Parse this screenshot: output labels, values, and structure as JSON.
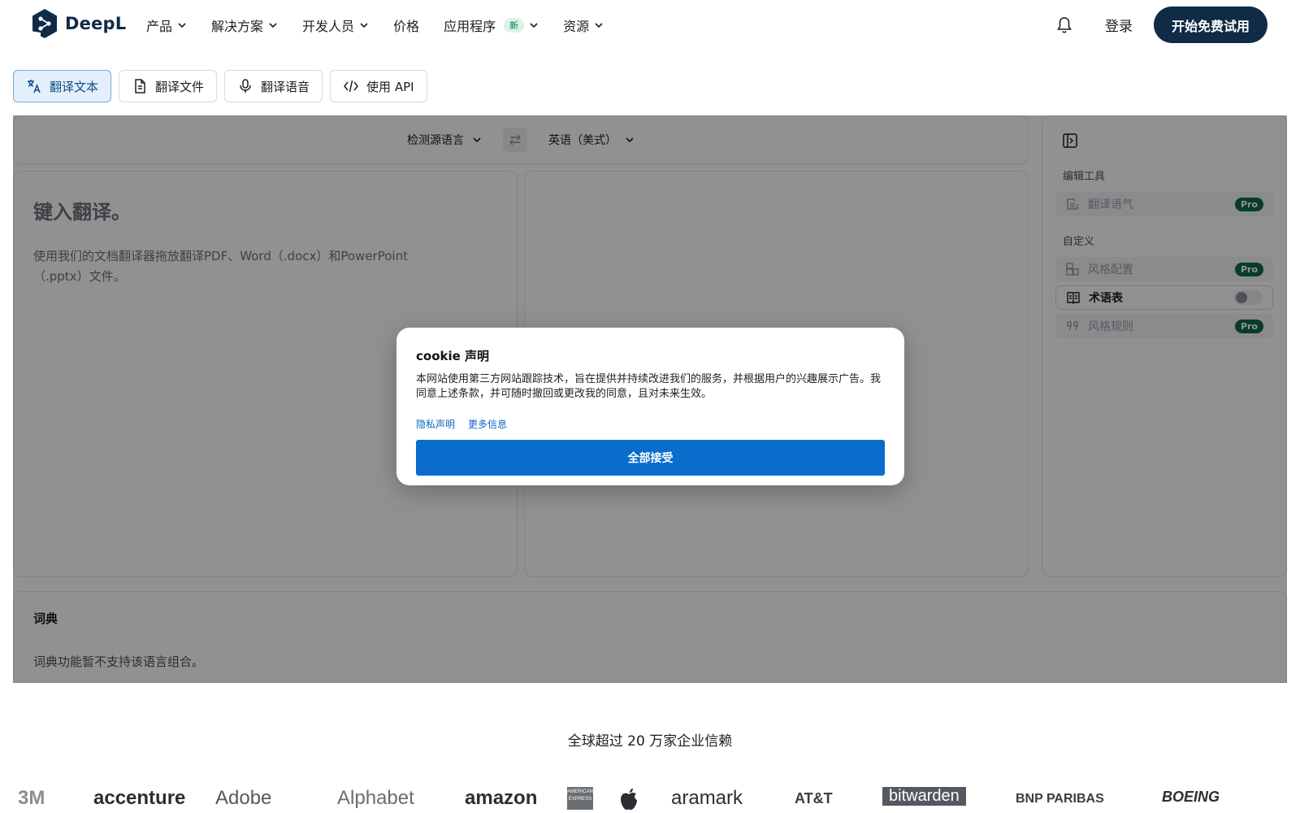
{
  "header": {
    "logo_text": "DeepL",
    "nav": [
      {
        "label": "产品",
        "has_menu": true
      },
      {
        "label": "解决方案",
        "has_menu": true
      },
      {
        "label": "开发人员",
        "has_menu": true
      },
      {
        "label": "价格",
        "has_menu": false
      },
      {
        "label": "应用程序",
        "badge": "新",
        "has_menu": true
      },
      {
        "label": "资源",
        "has_menu": true
      }
    ],
    "login": "登录",
    "cta": "开始免费试用"
  },
  "tabs": [
    {
      "label": "翻译文本",
      "icon": "translate-icon",
      "active": true
    },
    {
      "label": "翻译文件",
      "icon": "document-icon",
      "active": false
    },
    {
      "label": "翻译语音",
      "icon": "microphone-icon",
      "active": false
    },
    {
      "label": "使用 API",
      "icon": "code-icon",
      "active": false
    }
  ],
  "translator": {
    "source_lang": "检测源语言",
    "target_lang": "英语（美式）",
    "source_placeholder": "键入翻译。",
    "source_hint": "使用我们的文档翻译器拖放翻译PDF、Word（.docx）和PowerPoint（.pptx）文件。"
  },
  "sidebar": {
    "section_edit": "编辑工具",
    "section_custom": "自定义",
    "items": {
      "tone": {
        "label": "翻译语气",
        "badge": "Pro"
      },
      "style_config": {
        "label": "风格配置",
        "badge": "Pro"
      },
      "glossary": {
        "label": "术语表",
        "toggle_on": false
      },
      "style_rules": {
        "label": "风格规则",
        "badge": "Pro"
      }
    }
  },
  "dictionary": {
    "title": "词典",
    "message": "词典功能暂不支持该语言组合。"
  },
  "cookie": {
    "title": "cookie 声明",
    "body": "本网站使用第三方网站跟踪技术，旨在提供并持续改进我们的服务，并根据用户的兴趣展示广告。我同意上述条款，并可随时撤回或更改我的同意，且对未来生效。",
    "link_privacy": "隐私声明",
    "link_more": "更多信息",
    "accept": "全部接受"
  },
  "trust": {
    "headline": "全球超过 20 万家企业信赖",
    "brands": [
      "3M",
      "accenture",
      "Adobe",
      "Alphabet",
      "amazon",
      "AMERICAN EXPRESS",
      "apple-logo",
      "aramark",
      "AT&T",
      "bitwarden",
      "BNP PARIBAS",
      "BOEING"
    ]
  },
  "colors": {
    "brand_navy": "#0f2b46",
    "accept_blue": "#0a6ccb",
    "pro_green": "#0e6b45"
  }
}
